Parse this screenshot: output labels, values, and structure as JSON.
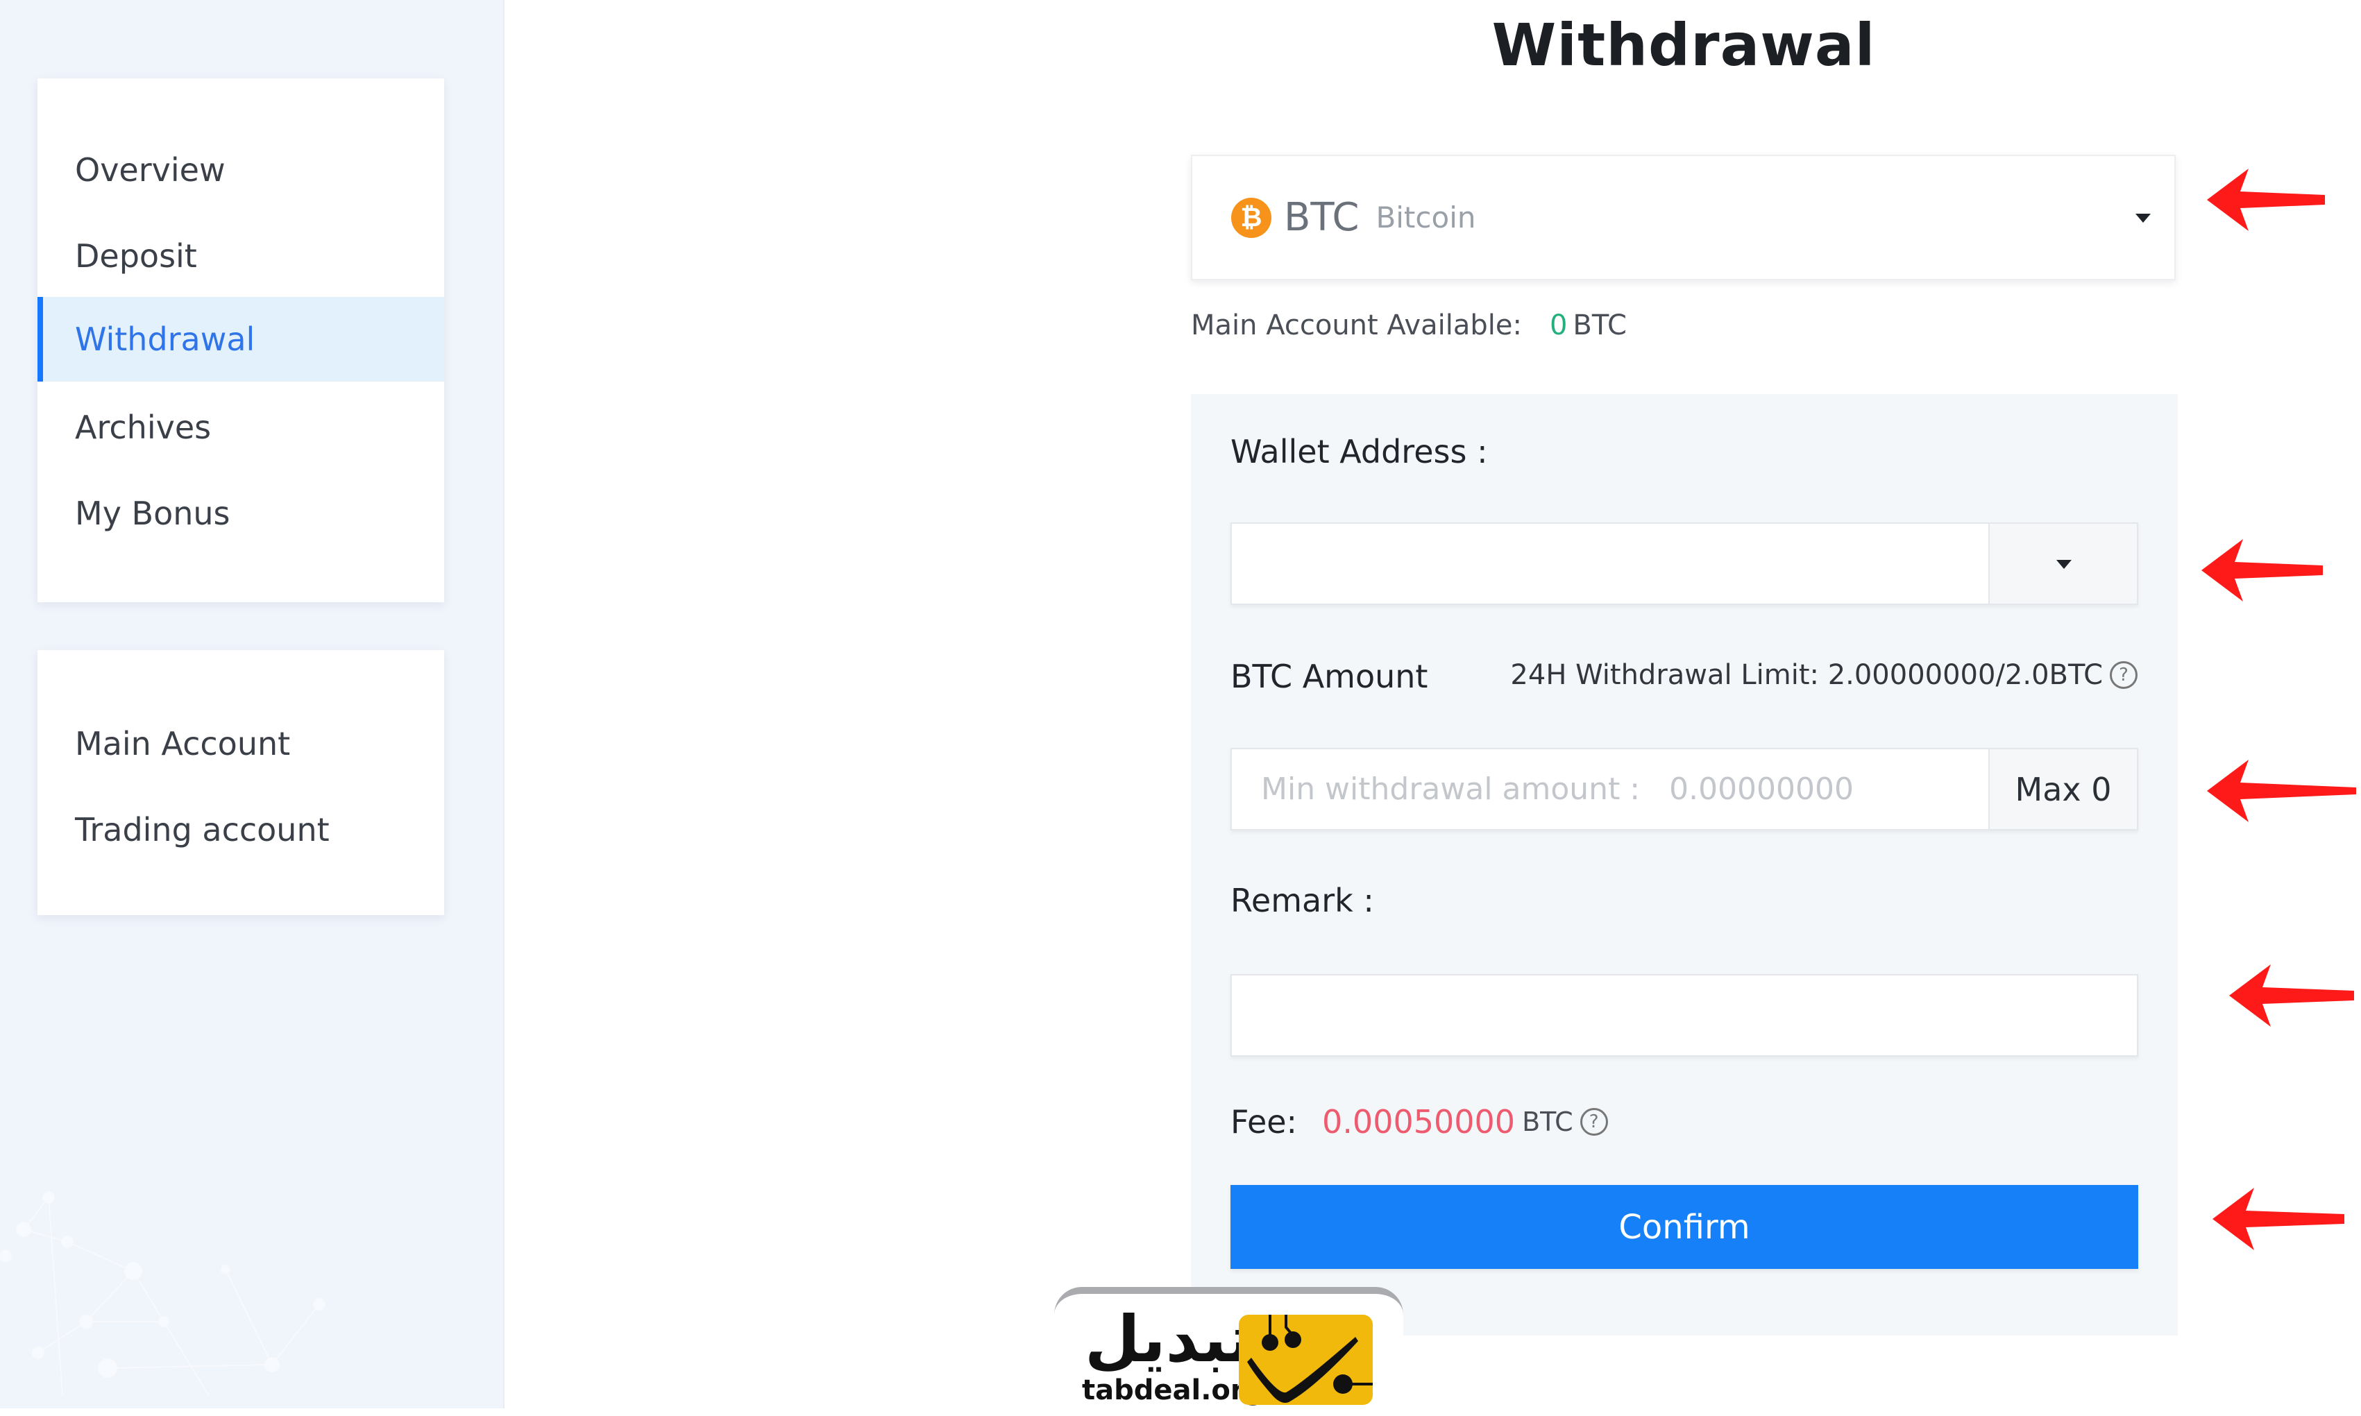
{
  "sidebar": {
    "nav_items": [
      {
        "label": "Overview",
        "active": false
      },
      {
        "label": "Deposit",
        "active": false
      },
      {
        "label": "Withdrawal",
        "active": true
      },
      {
        "label": "Archives",
        "active": false
      },
      {
        "label": "My Bonus",
        "active": false
      }
    ],
    "account_items": [
      {
        "label": "Main Account"
      },
      {
        "label": "Trading account"
      }
    ]
  },
  "page": {
    "title": "Withdrawal"
  },
  "coin_select": {
    "icon": "bitcoin-icon",
    "icon_glyph": "₿",
    "symbol": "BTC",
    "name": "Bitcoin"
  },
  "available": {
    "label": "Main Account Available:",
    "value": "0",
    "unit": "BTC"
  },
  "form": {
    "wallet_label": "Wallet Address :",
    "wallet_value": "",
    "wallet_placeholder": "",
    "amount_label": "BTC Amount",
    "limit_text": "24H Withdrawal Limit: 2.00000000/2.0BTC",
    "amount_placeholder": "Min withdrawal amount :   0.00000000",
    "amount_value": "",
    "max_label": "Max 0",
    "remark_label": "Remark :",
    "remark_value": "",
    "fee_label": "Fee:",
    "fee_value": "0.00050000",
    "fee_unit": "BTC",
    "help_glyph": "?",
    "confirm_label": "Confirm"
  },
  "colors": {
    "accent": "#1580f8",
    "active_nav_text": "#2f74e8",
    "active_nav_bg": "#e3f1fd",
    "available_value": "#23b07d",
    "fee_value": "#ee5a6e",
    "bitcoin": "#f7931a",
    "annotation_arrow": "#ff1a1a",
    "logo_yellow": "#f0b90b"
  },
  "watermark": {
    "text_fa": "تبدیل",
    "text_en": "tabdeal.org"
  }
}
